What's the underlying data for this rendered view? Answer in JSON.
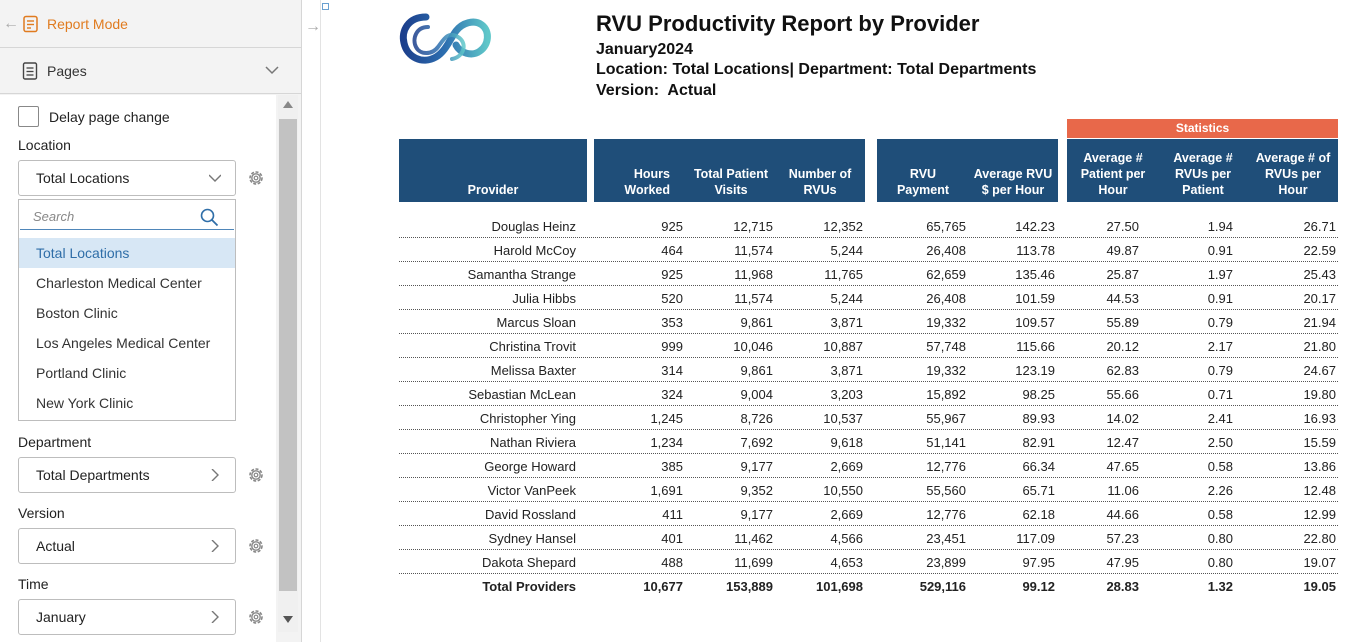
{
  "app": {
    "mode_label": "Report Mode",
    "pages_label": "Pages"
  },
  "filters": {
    "delay_label": "Delay page change",
    "location": {
      "label": "Location",
      "value": "Total Locations",
      "search_placeholder": "Search",
      "options": [
        "Total Locations",
        "Charleston Medical Center",
        "Boston Clinic",
        "Los Angeles Medical Center",
        "Portland Clinic",
        "New York Clinic"
      ]
    },
    "department": {
      "label": "Department",
      "value": "Total Departments"
    },
    "version": {
      "label": "Version",
      "value": "Actual"
    },
    "time": {
      "label": "Time",
      "value": "January"
    }
  },
  "report": {
    "title": "RVU Productivity Report by Provider",
    "period": "January2024",
    "location_line": "Location: Total Locations| Department: Total Departments",
    "version_line": "Version:  Actual",
    "stats_group": "Statistics",
    "headers": {
      "provider": "Provider",
      "hours": "Hours Worked",
      "visits": "Total Patient Visits",
      "rvus": "Number of RVUs",
      "payment": "RVU Payment",
      "avg_rvu_hour": "Average RVU $ per Hour",
      "avg_patient_hour": "Average # Patient per Hour",
      "avg_rvu_patient": "Average # RVUs per Patient",
      "avg_rvus_hour": "Average # of RVUs per Hour"
    },
    "rows": [
      [
        "Douglas Heinz",
        "925",
        "12,715",
        "12,352",
        "65,765",
        "142.23",
        "27.50",
        "1.94",
        "26.71"
      ],
      [
        "Harold McCoy",
        "464",
        "11,574",
        "5,244",
        "26,408",
        "113.78",
        "49.87",
        "0.91",
        "22.59"
      ],
      [
        "Samantha Strange",
        "925",
        "11,968",
        "11,765",
        "62,659",
        "135.46",
        "25.87",
        "1.97",
        "25.43"
      ],
      [
        "Julia Hibbs",
        "520",
        "11,574",
        "5,244",
        "26,408",
        "101.59",
        "44.53",
        "0.91",
        "20.17"
      ],
      [
        "Marcus Sloan",
        "353",
        "9,861",
        "3,871",
        "19,332",
        "109.57",
        "55.89",
        "0.79",
        "21.94"
      ],
      [
        "Christina Trovit",
        "999",
        "10,046",
        "10,887",
        "57,748",
        "115.66",
        "20.12",
        "2.17",
        "21.80"
      ],
      [
        "Melissa Baxter",
        "314",
        "9,861",
        "3,871",
        "19,332",
        "123.19",
        "62.83",
        "0.79",
        "24.67"
      ],
      [
        "Sebastian McLean",
        "324",
        "9,004",
        "3,203",
        "15,892",
        "98.25",
        "55.66",
        "0.71",
        "19.80"
      ],
      [
        "Christopher Ying",
        "1,245",
        "8,726",
        "10,537",
        "55,967",
        "89.93",
        "14.02",
        "2.41",
        "16.93"
      ],
      [
        "Nathan Riviera",
        "1,234",
        "7,692",
        "9,618",
        "51,141",
        "82.91",
        "12.47",
        "2.50",
        "15.59"
      ],
      [
        "George Howard",
        "385",
        "9,177",
        "2,669",
        "12,776",
        "66.34",
        "47.65",
        "0.58",
        "13.86"
      ],
      [
        "Victor VanPeek",
        "1,691",
        "9,352",
        "10,550",
        "55,560",
        "65.71",
        "11.06",
        "2.26",
        "12.48"
      ],
      [
        "David Rossland",
        "411",
        "9,177",
        "2,669",
        "12,776",
        "62.18",
        "44.66",
        "0.58",
        "12.99"
      ],
      [
        "Sydney Hansel",
        "401",
        "11,462",
        "4,566",
        "23,451",
        "117.09",
        "57.23",
        "0.80",
        "22.80"
      ],
      [
        "Dakota Shepard",
        "488",
        "11,699",
        "4,653",
        "23,899",
        "97.95",
        "47.95",
        "0.80",
        "19.07"
      ]
    ],
    "total": [
      "Total Providers",
      "10,677",
      "153,889",
      "101,698",
      "529,116",
      "99.12",
      "28.83",
      "1.32",
      "19.05"
    ]
  },
  "colors": {
    "header_navy": "#1f4e79",
    "statistics_orange": "#e8684a",
    "accent_orange": "#e07b1f",
    "selected_blue": "#d7e7f5"
  }
}
